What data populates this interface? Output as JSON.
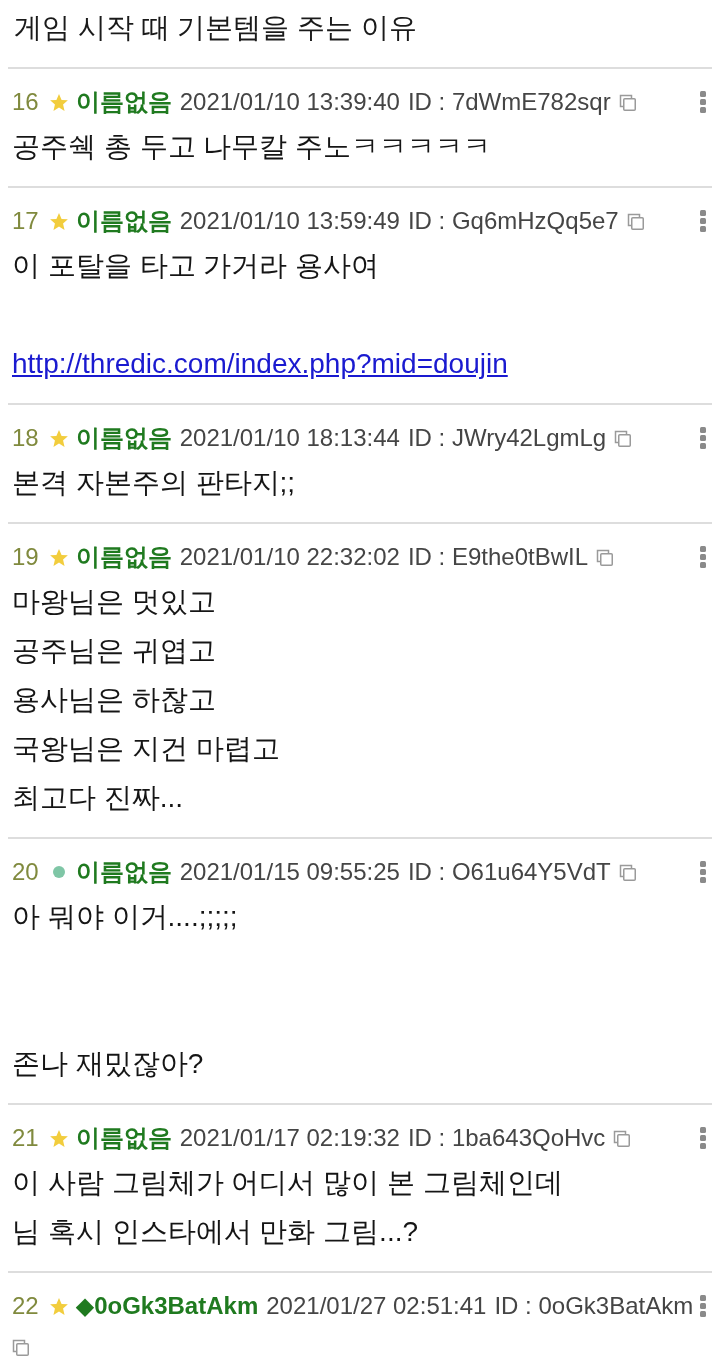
{
  "title": "게임 시작 때 기본템을 주는 이유",
  "posts": [
    {
      "number": "16",
      "badge": {
        "kind": "star"
      },
      "name": "이름없음",
      "date": "2021/01/10 13:39:40",
      "id": "ID : 7dWmE782sqr",
      "lines": [
        {
          "kind": "text",
          "text": "공주쉑 총 두고 나무칼 주노ㅋㅋㅋㅋㅋ"
        }
      ]
    },
    {
      "number": "17",
      "badge": {
        "kind": "star"
      },
      "name": "이름없음",
      "date": "2021/01/10 13:59:49",
      "id": "ID : Gq6mHzQq5e7",
      "lines": [
        {
          "kind": "text",
          "text": "이 포탈을 타고 가거라 용사여"
        },
        {
          "kind": "blank"
        },
        {
          "kind": "link",
          "text": "http://thredic.com/index.php?mid=doujin"
        }
      ]
    },
    {
      "number": "18",
      "badge": {
        "kind": "star"
      },
      "name": "이름없음",
      "date": "2021/01/10 18:13:44",
      "id": "ID : JWry42LgmLg",
      "lines": [
        {
          "kind": "text",
          "text": "본격 자본주의 판타지;;"
        }
      ]
    },
    {
      "number": "19",
      "badge": {
        "kind": "star"
      },
      "name": "이름없음",
      "date": "2021/01/10 22:32:02",
      "id": "ID : E9the0tBwIL",
      "lines": [
        {
          "kind": "text",
          "text": "마왕님은 멋있고"
        },
        {
          "kind": "text",
          "text": "공주님은 귀엽고"
        },
        {
          "kind": "text",
          "text": "용사님은 하찮고"
        },
        {
          "kind": "text",
          "text": "국왕님은 지건 마렵고"
        },
        {
          "kind": "text",
          "text": "최고다 진짜..."
        }
      ]
    },
    {
      "number": "20",
      "badge": {
        "kind": "dot",
        "color": "#7fc6a6"
      },
      "name": "이름없음",
      "date": "2021/01/15 09:55:25",
      "id": "ID : O61u64Y5VdT",
      "lines": [
        {
          "kind": "text",
          "text": "아 뭐야 이거....;;;;;"
        },
        {
          "kind": "blank"
        },
        {
          "kind": "blank"
        },
        {
          "kind": "text",
          "text": "존나 재밌잖아?"
        }
      ]
    },
    {
      "number": "21",
      "badge": {
        "kind": "star"
      },
      "name": "이름없음",
      "date": "2021/01/17 02:19:32",
      "id": "ID : 1ba643QoHvc",
      "lines": [
        {
          "kind": "text",
          "text": "이 사람 그림체가 어디서 많이 본 그림체인데"
        },
        {
          "kind": "text",
          "text": "님 혹시 인스타에서 만화 그림...?"
        }
      ]
    },
    {
      "number": "22",
      "badge": {
        "kind": "star"
      },
      "name": "◆0oGk3BatAkm",
      "date": "2021/01/27 02:51:41",
      "id": "ID : 0oGk3BatAkm"
    }
  ]
}
